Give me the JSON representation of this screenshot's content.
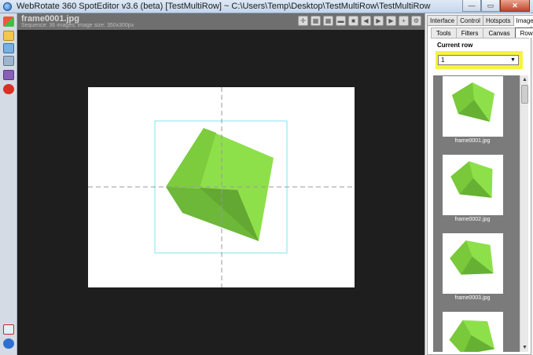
{
  "window": {
    "title": "WebRotate 360 SpotEditor v3.6 (beta) [TestMultiRow] ~ C:\\Users\\Temp\\Desktop\\TestMultiRow\\TestMultiRow",
    "min_glyph": "—",
    "max_glyph": "▭",
    "close_glyph": "✕"
  },
  "viewer": {
    "file_name": "frame0001.jpg",
    "sequence_info": "Sequence: 36 images; image size: 350x300px",
    "cube_color": "#8ee04a"
  },
  "top_icons": [
    "fit-icon",
    "grid-icon",
    "grid-icon",
    "minus-icon",
    "stop-icon",
    "prev-icon",
    "play-icon",
    "next-icon",
    "plus-icon",
    "settings-icon"
  ],
  "panel": {
    "tabs": [
      "Interface",
      "Control",
      "Hotspots",
      "Images"
    ],
    "active_tab": "Images",
    "subtabs": [
      "Tools",
      "Filters",
      "Canvas",
      "Rows"
    ],
    "active_subtab": "Rows",
    "current_row_label": "Current row",
    "current_row_value": "1",
    "highlight_color": "#f6f240"
  },
  "thumbnails": [
    {
      "caption": "frame0001.jpg"
    },
    {
      "caption": "frame0002.jpg"
    },
    {
      "caption": "frame0003.jpg"
    }
  ]
}
